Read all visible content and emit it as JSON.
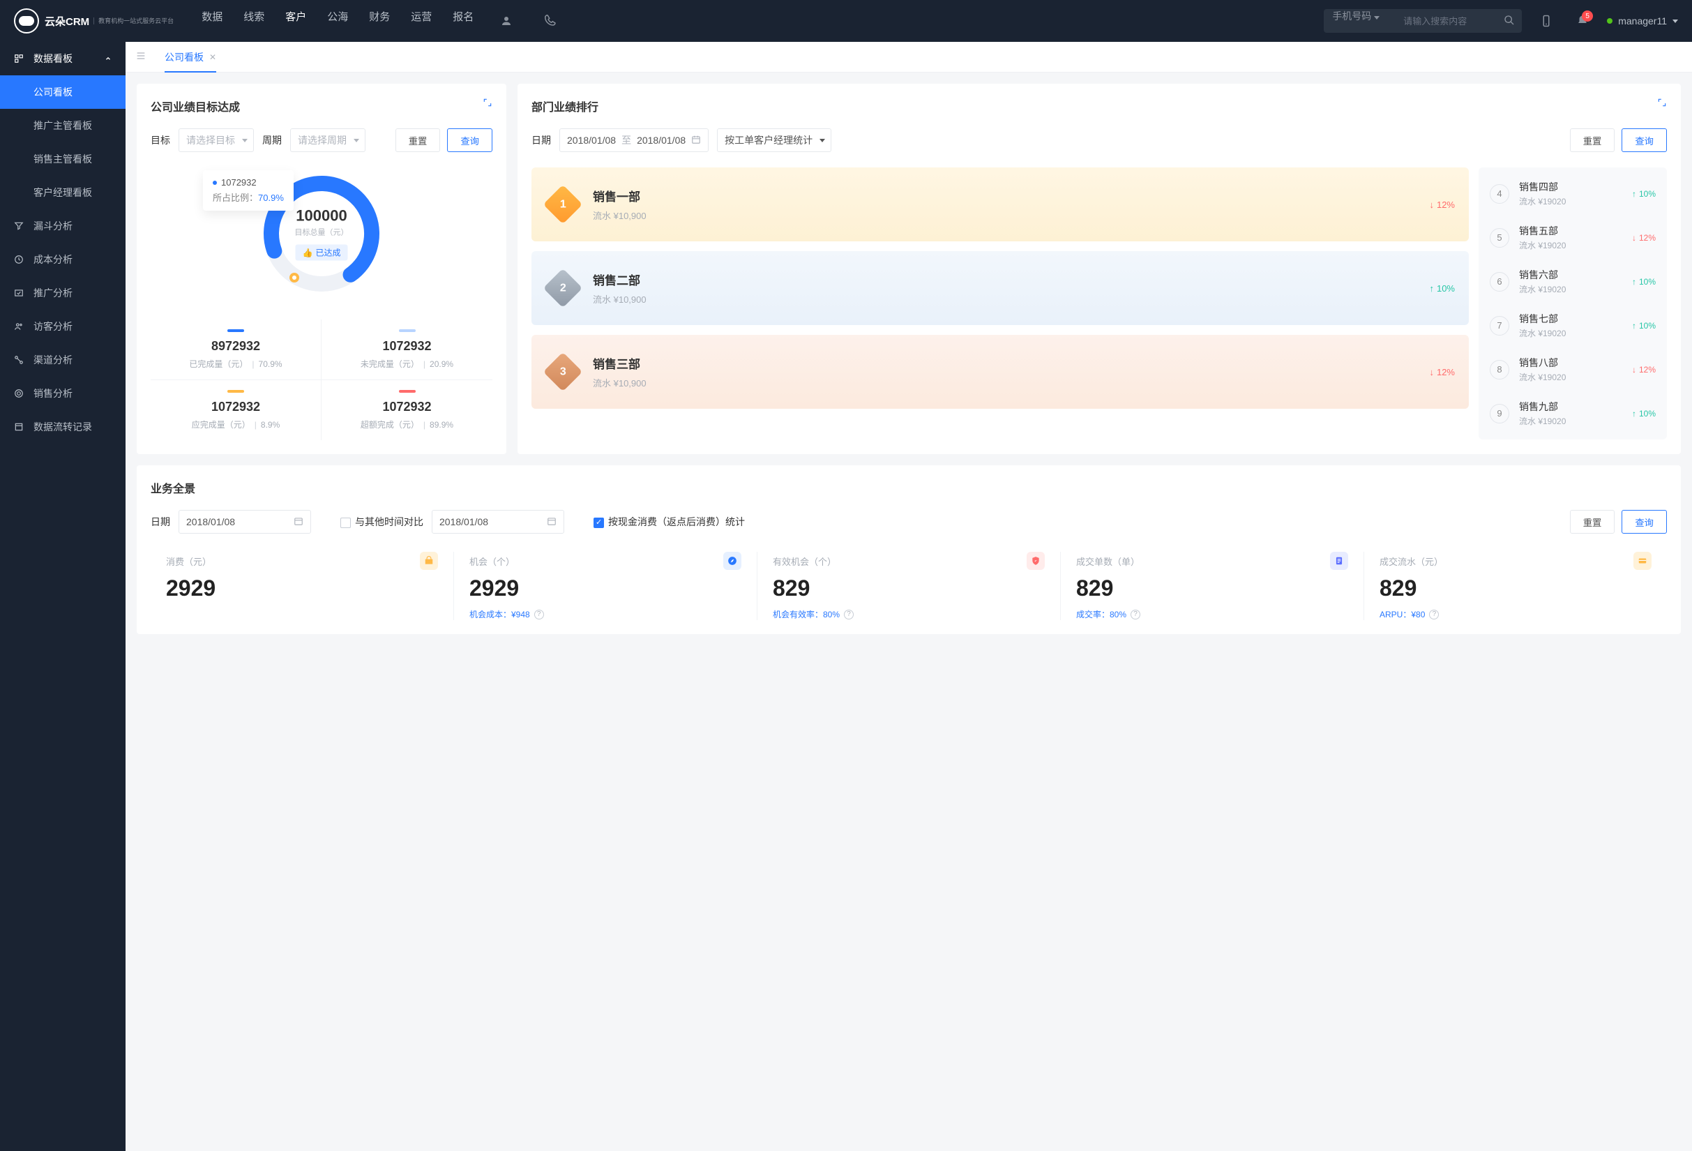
{
  "topbar": {
    "logo_text": "云朵CRM",
    "logo_sub": "教育机构一站式服务云平台",
    "nav": [
      "数据",
      "线索",
      "客户",
      "公海",
      "财务",
      "运营",
      "报名"
    ],
    "search_type": "手机号码",
    "search_placeholder": "请输入搜索内容",
    "badge": "5",
    "username": "manager11"
  },
  "sidebar": {
    "group": {
      "label": "数据看板"
    },
    "subs": [
      "公司看板",
      "推广主管看板",
      "销售主管看板",
      "客户经理看板"
    ],
    "items": [
      "漏斗分析",
      "成本分析",
      "推广分析",
      "访客分析",
      "渠道分析",
      "销售分析",
      "数据流转记录"
    ]
  },
  "tabs": {
    "t1": "公司看板"
  },
  "card1": {
    "title": "公司业绩目标达成",
    "filter_target": "目标",
    "filter_target_ph": "请选择目标",
    "filter_period": "周期",
    "filter_period_ph": "请选择周期",
    "reset": "重置",
    "query": "查询",
    "donut": {
      "center_value": "100000",
      "center_label": "目标总量（元）",
      "status": "已达成"
    },
    "tooltip": {
      "v": "1072932",
      "label": "所占比例：",
      "pct": "70.9%"
    },
    "stats": [
      {
        "color": "#2878ff",
        "v": "8972932",
        "l": "已完成量（元）",
        "p": "70.9%"
      },
      {
        "color": "#b8d4ff",
        "v": "1072932",
        "l": "未完成量（元）",
        "p": "20.9%"
      },
      {
        "color": "#ffb946",
        "v": "1072932",
        "l": "应完成量（元）",
        "p": "8.9%"
      },
      {
        "color": "#ff6b6b",
        "v": "1072932",
        "l": "超额完成（元）",
        "p": "89.9%"
      }
    ]
  },
  "card2": {
    "title": "部门业绩排行",
    "date_label": "日期",
    "date1": "2018/01/08",
    "date_sep": "至",
    "date2": "2018/01/08",
    "stat_by": "按工单客户经理统计",
    "reset": "重置",
    "query": "查询",
    "podium": [
      {
        "rank": "1",
        "name": "销售一部",
        "sub": "流水 ¥10,900",
        "trend": "12%",
        "dir": "down",
        "bg": "linear-gradient(180deg,#fff6e3,#fdf1d4)",
        "med": "linear-gradient(135deg,#ffb946,#ff9a2e)"
      },
      {
        "rank": "2",
        "name": "销售二部",
        "sub": "流水 ¥10,900",
        "trend": "10%",
        "dir": "up",
        "bg": "linear-gradient(180deg,#f2f7fc,#e9f1fa)",
        "med": "linear-gradient(135deg,#b8c2cc,#8f99a6)"
      },
      {
        "rank": "3",
        "name": "销售三部",
        "sub": "流水 ¥10,900",
        "trend": "12%",
        "dir": "down",
        "bg": "linear-gradient(180deg,#fdf1eb,#fceade)",
        "med": "linear-gradient(135deg,#e8a87c,#d1885a)"
      }
    ],
    "list": [
      {
        "n": "4",
        "name": "销售四部",
        "sub": "流水 ¥19020",
        "trend": "10%",
        "dir": "up"
      },
      {
        "n": "5",
        "name": "销售五部",
        "sub": "流水 ¥19020",
        "trend": "12%",
        "dir": "down"
      },
      {
        "n": "6",
        "name": "销售六部",
        "sub": "流水 ¥19020",
        "trend": "10%",
        "dir": "up"
      },
      {
        "n": "7",
        "name": "销售七部",
        "sub": "流水 ¥19020",
        "trend": "10%",
        "dir": "up"
      },
      {
        "n": "8",
        "name": "销售八部",
        "sub": "流水 ¥19020",
        "trend": "12%",
        "dir": "down"
      },
      {
        "n": "9",
        "name": "销售九部",
        "sub": "流水 ¥19020",
        "trend": "10%",
        "dir": "up"
      }
    ]
  },
  "card3": {
    "title": "业务全景",
    "date_label": "日期",
    "date1": "2018/01/08",
    "compare_label": "与其他时间对比",
    "date2": "2018/01/08",
    "check_label": "按现金消费（返点后消费）统计",
    "reset": "重置",
    "query": "查询",
    "kpis": [
      {
        "t": "消费（元）",
        "v": "2929",
        "foot": "",
        "ic_bg": "#fff2d9",
        "ic_fg": "#ffb946",
        "ic": "bag"
      },
      {
        "t": "机会（个）",
        "v": "2929",
        "foot": "机会成本：¥948",
        "ic_bg": "#e6f0ff",
        "ic_fg": "#2878ff",
        "ic": "nav"
      },
      {
        "t": "有效机会（个）",
        "v": "829",
        "foot": "机会有效率：80%",
        "ic_bg": "#ffeceb",
        "ic_fg": "#ff6b6b",
        "ic": "shield"
      },
      {
        "t": "成交单数（单）",
        "v": "829",
        "foot": "成交率：80%",
        "ic_bg": "#e8ecff",
        "ic_fg": "#5a6dff",
        "ic": "doc"
      },
      {
        "t": "成交流水（元）",
        "v": "829",
        "foot": "ARPU：¥80",
        "ic_bg": "#fff2d9",
        "ic_fg": "#ffb946",
        "ic": "card"
      }
    ]
  },
  "chart_data": {
    "type": "pie",
    "title": "公司业绩目标达成",
    "total": 100000,
    "series": [
      {
        "name": "已完成量（元）",
        "value": 8972932,
        "pct": 70.9,
        "color": "#2878ff"
      },
      {
        "name": "未完成量（元）",
        "value": 1072932,
        "pct": 20.9,
        "color": "#b8d4ff"
      },
      {
        "name": "应完成量（元）",
        "value": 1072932,
        "pct": 8.9,
        "color": "#ffb946"
      },
      {
        "name": "超额完成（元）",
        "value": 1072932,
        "pct": 89.9,
        "color": "#ff6b6b"
      }
    ]
  }
}
